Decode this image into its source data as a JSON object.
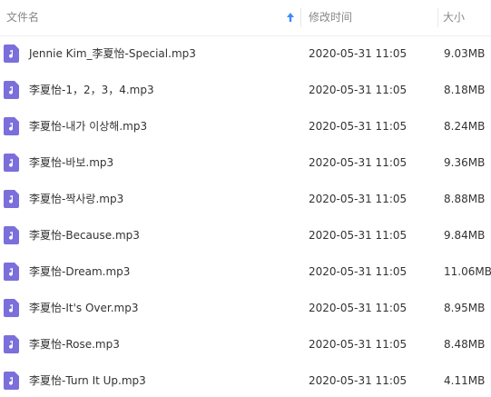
{
  "header": {
    "name_label": "文件名",
    "modified_label": "修改时间",
    "size_label": "大小",
    "sort_icon": "sort-ascending-arrow-icon"
  },
  "colors": {
    "header_text": "#888888",
    "sort_arrow": "#3b8cff",
    "file_icon": "#7b6fdc"
  },
  "files": [
    {
      "name": "Jennie Kim_李夏怡-Special.mp3",
      "modified": "2020-05-31 11:05",
      "size": "9.03MB",
      "icon": "audio-file-icon"
    },
    {
      "name": "李夏怡-1，2，3，4.mp3",
      "modified": "2020-05-31 11:05",
      "size": "8.18MB",
      "icon": "audio-file-icon"
    },
    {
      "name": "李夏怡-내가 이상해.mp3",
      "modified": "2020-05-31 11:05",
      "size": "8.24MB",
      "icon": "audio-file-icon"
    },
    {
      "name": "李夏怡-바보.mp3",
      "modified": "2020-05-31 11:05",
      "size": "9.36MB",
      "icon": "audio-file-icon"
    },
    {
      "name": "李夏怡-짝사랑.mp3",
      "modified": "2020-05-31 11:05",
      "size": "8.88MB",
      "icon": "audio-file-icon"
    },
    {
      "name": "李夏怡-Because.mp3",
      "modified": "2020-05-31 11:05",
      "size": "9.84MB",
      "icon": "audio-file-icon"
    },
    {
      "name": "李夏怡-Dream.mp3",
      "modified": "2020-05-31 11:05",
      "size": "11.06MB",
      "icon": "audio-file-icon"
    },
    {
      "name": "李夏怡-It's Over.mp3",
      "modified": "2020-05-31 11:05",
      "size": "8.95MB",
      "icon": "audio-file-icon"
    },
    {
      "name": "李夏怡-Rose.mp3",
      "modified": "2020-05-31 11:05",
      "size": "8.48MB",
      "icon": "audio-file-icon"
    },
    {
      "name": "李夏怡-Turn It Up.mp3",
      "modified": "2020-05-31 11:05",
      "size": "4.11MB",
      "icon": "audio-file-icon"
    }
  ]
}
